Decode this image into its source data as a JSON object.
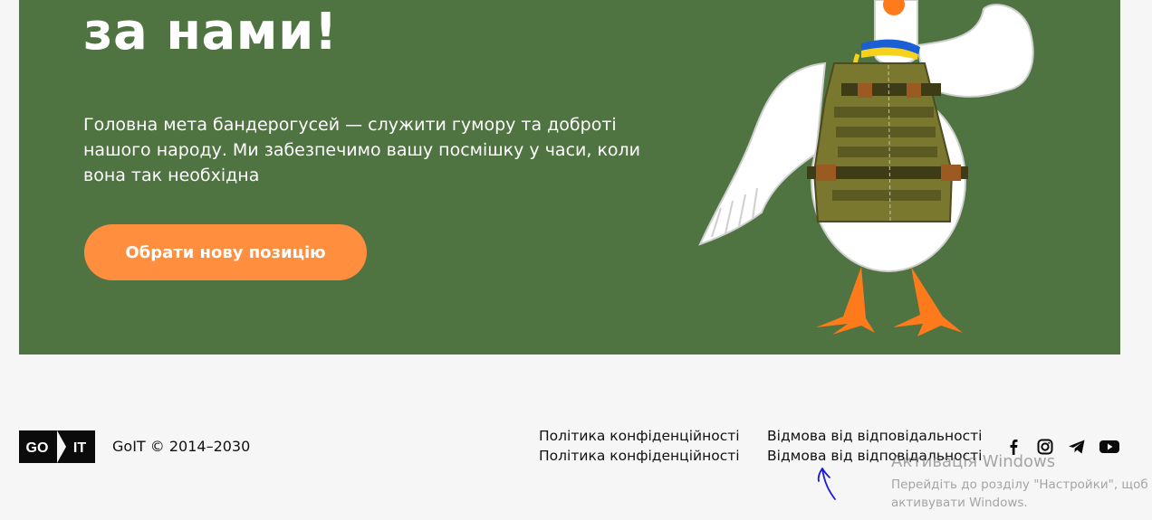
{
  "hero": {
    "title_line_prev": "",
    "title_line": "за нами!",
    "text": "Головна мета бандерогусей — служити гумору та доброті нашого народу. Ми забезпечимо вашу посмішку у часи, коли вона так необхідна",
    "cta_label": "Обрати нову позицію",
    "background_color": "#4f7441",
    "cta_color": "#ff8f3f"
  },
  "footer": {
    "logo_left": "GO",
    "logo_right": "IT",
    "copyright": "GoIT © 2014–2030",
    "links": [
      {
        "label": "Політика конфіденційності"
      },
      {
        "label": "Відмова від відповідальності"
      },
      {
        "label": "Політика конфіденційності"
      },
      {
        "label": "Відмова від відповідальності"
      }
    ],
    "socials": [
      "facebook-icon",
      "instagram-icon",
      "telegram-icon",
      "youtube-icon"
    ]
  },
  "windows_activation": {
    "title": "Активація Windows",
    "line1": "Перейдіть до розділу \"Настройки\", щоб",
    "line2": "активувати Windows."
  }
}
